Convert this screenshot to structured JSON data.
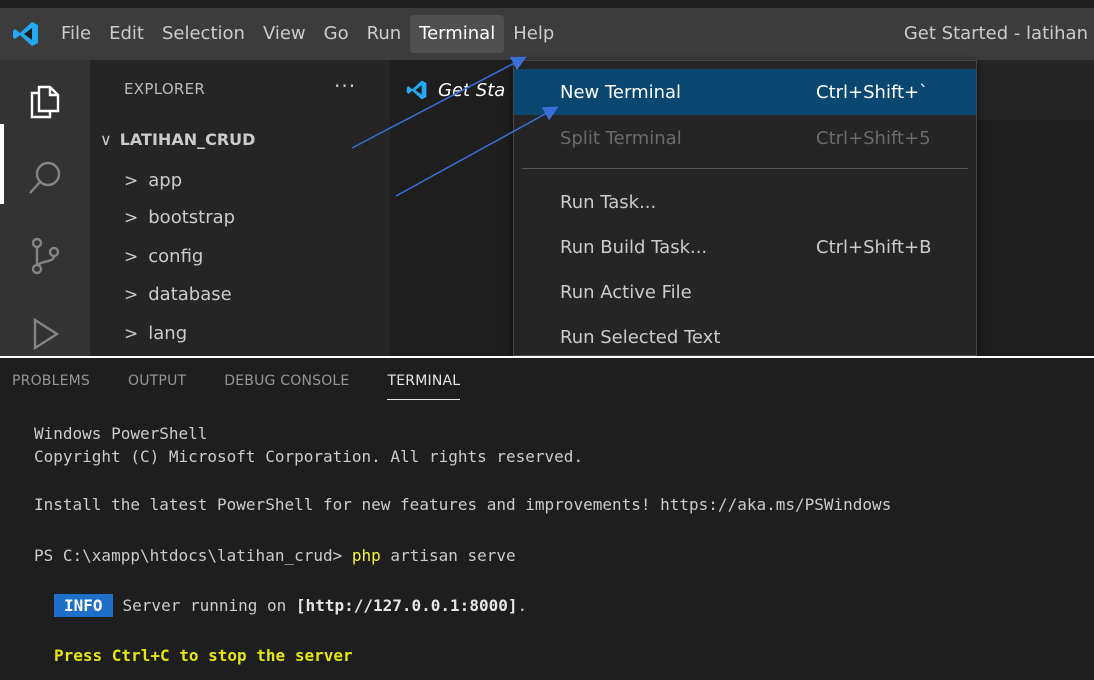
{
  "app": {
    "window_title": "Get Started - latihan"
  },
  "menubar": [
    {
      "id": "file",
      "label": "File"
    },
    {
      "id": "edit",
      "label": "Edit"
    },
    {
      "id": "selection",
      "label": "Selection"
    },
    {
      "id": "view",
      "label": "View"
    },
    {
      "id": "go",
      "label": "Go"
    },
    {
      "id": "run",
      "label": "Run"
    },
    {
      "id": "terminal",
      "label": "Terminal",
      "active": true
    },
    {
      "id": "help",
      "label": "Help"
    }
  ],
  "activitybar": {
    "icons": [
      "explorer-icon",
      "search-icon",
      "source-control-icon",
      "run-debug-icon"
    ],
    "active": "explorer-icon"
  },
  "sidebar": {
    "title": "EXPLORER",
    "more": "···",
    "project": "LATIHAN_CRUD",
    "folders": [
      "app",
      "bootstrap",
      "config",
      "database",
      "lang"
    ]
  },
  "editor": {
    "tab_label": "Get Sta"
  },
  "terminal_menu": {
    "items": [
      {
        "label": "New Terminal",
        "shortcut": "Ctrl+Shift+`",
        "state": "selected"
      },
      {
        "label": "Split Terminal",
        "shortcut": "Ctrl+Shift+5",
        "state": "disabled"
      },
      {
        "label": "Run Task...",
        "shortcut": "",
        "state": "normal"
      },
      {
        "label": "Run Build Task...",
        "shortcut": "Ctrl+Shift+B",
        "state": "normal"
      },
      {
        "label": "Run Active File",
        "shortcut": "",
        "state": "normal"
      },
      {
        "label": "Run Selected Text",
        "shortcut": "",
        "state": "normal"
      }
    ]
  },
  "panel": {
    "tabs": [
      {
        "label": "PROBLEMS",
        "active": false
      },
      {
        "label": "OUTPUT",
        "active": false
      },
      {
        "label": "DEBUG CONSOLE",
        "active": false
      },
      {
        "label": "TERMINAL",
        "active": true
      }
    ],
    "terminal": {
      "line1": "Windows PowerShell",
      "line2": "Copyright (C) Microsoft Corporation. All rights reserved.",
      "line3": "Install the latest PowerShell for new features and improvements! https://aka.ms/PSWindows",
      "prompt": "PS C:\\xampp\\htdocs\\latihan_crud> ",
      "cmd_keyword": "php",
      "cmd_rest": " artisan serve",
      "info_badge": "INFO",
      "info_prefix": "Server running on ",
      "info_url": "[http://127.0.0.1:8000]",
      "info_suffix": ".",
      "stop_hint": "Press Ctrl+C to stop the server"
    }
  },
  "colors": {
    "accent": "#094771",
    "info_badge": "#1e6fc7",
    "annotation_arrow": "#3a6fd8",
    "php_keyword": "#f5f543"
  }
}
